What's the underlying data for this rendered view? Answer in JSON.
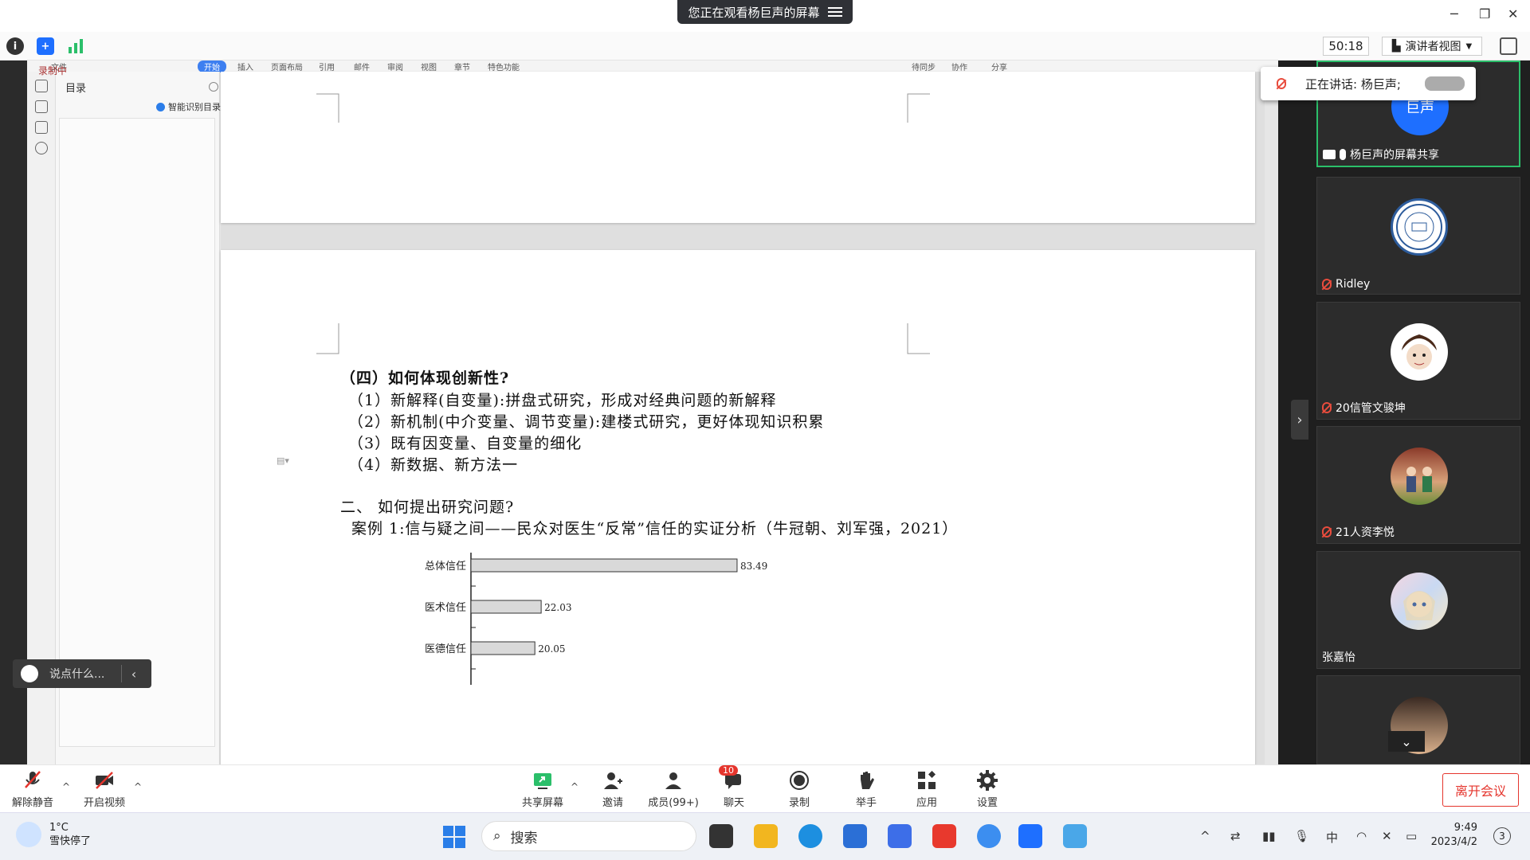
{
  "banner": {
    "text": "您正在观看杨巨声的屏幕"
  },
  "toolbar": {
    "timer": "50:18",
    "view_mode": "演讲者视图"
  },
  "doc": {
    "ribbon_tabs": [
      "文件",
      "开始",
      "插入",
      "页面布局",
      "引用",
      "邮件",
      "审阅",
      "视图",
      "章节",
      "特色功能"
    ],
    "ribbon_right": [
      "待同步",
      "协作",
      "分享"
    ],
    "recording_label": "录制中",
    "toc_title": "目录",
    "toc_smart": "智能识别目录",
    "lines": [
      "（四）如何体现创新性?",
      "（1）新解释(自变量):拼盘式研究，形成对经典问题的新解释",
      "（2）新机制(中介变量、调节变量):建楼式研究，更好体现知识积累",
      "（3）既有因变量、自变量的细化",
      "（4）新数据、新方法一",
      "二、  如何提出研究问题?",
      "案例 1:信与疑之间——民众对医生“反常”信任的实证分析（牛冠朝、刘军强，2021）"
    ]
  },
  "chart_data": {
    "type": "bar",
    "orientation": "horizontal",
    "categories": [
      "总体信任",
      "医术信任",
      "医德信任"
    ],
    "values": [
      83.49,
      22.03,
      20.05
    ],
    "value_labels": [
      "83.49",
      "22.03",
      "20.05"
    ],
    "xlim": [
      0,
      100
    ]
  },
  "speaker": {
    "label": "正在讲话: 杨巨声;"
  },
  "participants": [
    {
      "name": "杨巨声的屏幕共享",
      "avatar_text": "巨声",
      "color": "#1e6fff"
    },
    {
      "name": "Ridley"
    },
    {
      "name": "20信管文骏坤"
    },
    {
      "name": "21人资李悦"
    },
    {
      "name": "张嘉怡"
    },
    {
      "name": ""
    }
  ],
  "chat": {
    "placeholder": "说点什么..."
  },
  "controls": {
    "unmute": "解除静音",
    "video": "开启视频",
    "share": "共享屏幕",
    "invite": "邀请",
    "members": "成员(99+)",
    "chat": "聊天",
    "chat_badge": "10",
    "record": "录制",
    "raise_hand": "举手",
    "apps": "应用",
    "settings": "设置",
    "leave": "离开会议"
  },
  "taskbar": {
    "temp": "1°C",
    "weather": "雪快停了",
    "search": "搜索",
    "ime": "中",
    "time": "9:49",
    "date": "2023/4/2",
    "notif_count": "3"
  }
}
